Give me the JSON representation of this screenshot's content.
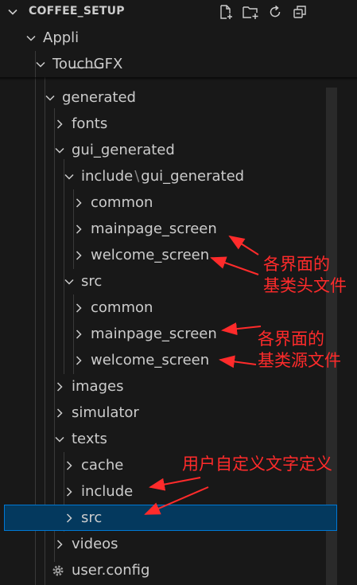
{
  "explorer": {
    "section_title": "COFFEE_SETUP",
    "actions": [
      {
        "icon": "new-file-icon"
      },
      {
        "icon": "new-folder-icon"
      },
      {
        "icon": "refresh-icon"
      },
      {
        "icon": "collapse-all-icon"
      }
    ]
  },
  "tree": {
    "appli": "Appli",
    "touchgfx": "TouchGFX",
    "generated": "generated",
    "fonts": "fonts",
    "gui_generated": "gui_generated",
    "include_path": "include",
    "include_path_sep": "\\",
    "include_path_tail": "gui_generated",
    "inc_common": "common",
    "inc_mainpage": "mainpage_screen",
    "inc_welcome": "welcome_screen",
    "src": "src",
    "src_common": "common",
    "src_mainpage": "mainpage_screen",
    "src_welcome": "welcome_screen",
    "images": "images",
    "simulator": "simulator",
    "texts": "texts",
    "texts_cache": "cache",
    "texts_include": "include",
    "texts_src": "src",
    "videos": "videos",
    "user_config": "user.config"
  },
  "annotations": {
    "header_line1": "各界面的",
    "header_line2": "基类头文件",
    "source_line1": "各界面的",
    "source_line2": "基类源文件",
    "texts": "用户自定义文字定义"
  },
  "colors": {
    "annotation": "#ff2b2b",
    "selection_bg": "#04395e",
    "selection_border": "#0078d4"
  }
}
